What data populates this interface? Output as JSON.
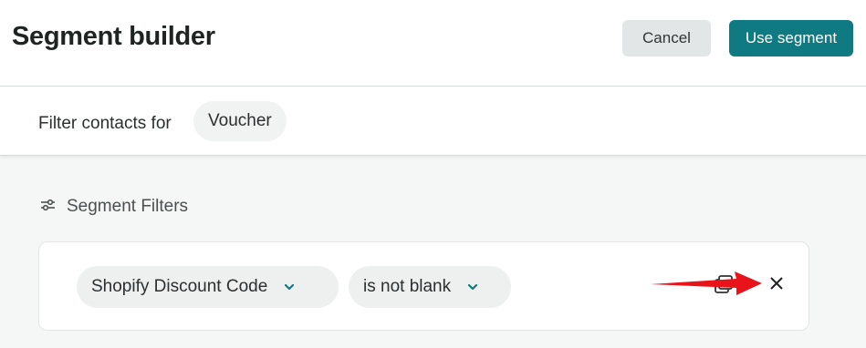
{
  "header": {
    "title": "Segment builder",
    "cancel_label": "Cancel",
    "use_segment_label": "Use segment"
  },
  "filter_bar": {
    "label": "Filter contacts for",
    "audience": "Voucher"
  },
  "segment": {
    "title": "Segment Filters",
    "condition": {
      "field": "Shopify Discount Code",
      "operator": "is not blank"
    }
  },
  "colors": {
    "accent": "#0f7a81",
    "annotation_arrow": "#e8141a"
  },
  "icons": [
    "sliders-icon",
    "chevron-down-icon",
    "copy-icon",
    "close-icon",
    "arrow-annotation"
  ]
}
